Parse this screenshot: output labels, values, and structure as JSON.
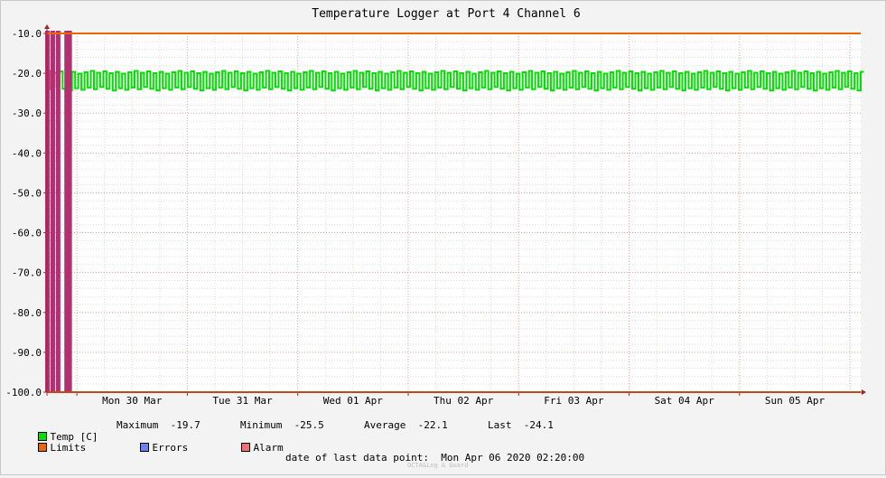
{
  "chart_data": {
    "type": "line",
    "title": "Temperature Logger at Port 4 Channel 6",
    "ylim": [
      -100.0,
      -10.0
    ],
    "y_ticks": [
      "-10.0",
      "-20.0",
      "-30.0",
      "-40.0",
      "-50.0",
      "-60.0",
      "-70.0",
      "-80.0",
      "-90.0",
      "-100.0"
    ],
    "x_ticks": [
      "Mon 30 Mar",
      "Tue 31 Mar",
      "Wed 01 Apr",
      "Thu 02 Apr",
      "Fri 03 Apr",
      "Sat 04 Apr",
      "Sun 05 Apr"
    ],
    "x_range_days": [
      "2020-03-29T17:30",
      "2020-04-06T02:20"
    ],
    "series": [
      {
        "name": "Temp [C]",
        "color": "#00e000",
        "band_upper": -19.7,
        "band_lower": -25.5,
        "typical": -22.1
      },
      {
        "name": "Limits",
        "color": "#ee6600",
        "values": [
          -10.0,
          -100.0
        ]
      },
      {
        "name": "Alarm",
        "color": "#b03070",
        "intervals": [
          "2020-03-29T17:30",
          "2020-03-29T18:40",
          "2020-03-29T19:50",
          "2020-03-29T21:40",
          "2020-03-29T22:20"
        ]
      }
    ],
    "grid": true
  },
  "legend": {
    "temp_label": "Temp [C]",
    "max_label": "Maximum",
    "max_value": "-19.7",
    "min_label": "Minimum",
    "min_value": "-25.5",
    "avg_label": "Average",
    "avg_value": "-22.1",
    "last_label": "Last",
    "last_value": "-24.1",
    "limits_label": "Limits",
    "errors_label": "Errors",
    "alarm_label": "Alarm",
    "colors": {
      "temp": "#00e000",
      "limits": "#ee6600",
      "errors": "#6f7fef",
      "alarm": "#f07070"
    }
  },
  "footer": {
    "last_point_label": "date of last data point:",
    "last_point_value": "Mon Apr 06 2020 02:20:00",
    "watermark": "OCTA&Log & Guard"
  }
}
